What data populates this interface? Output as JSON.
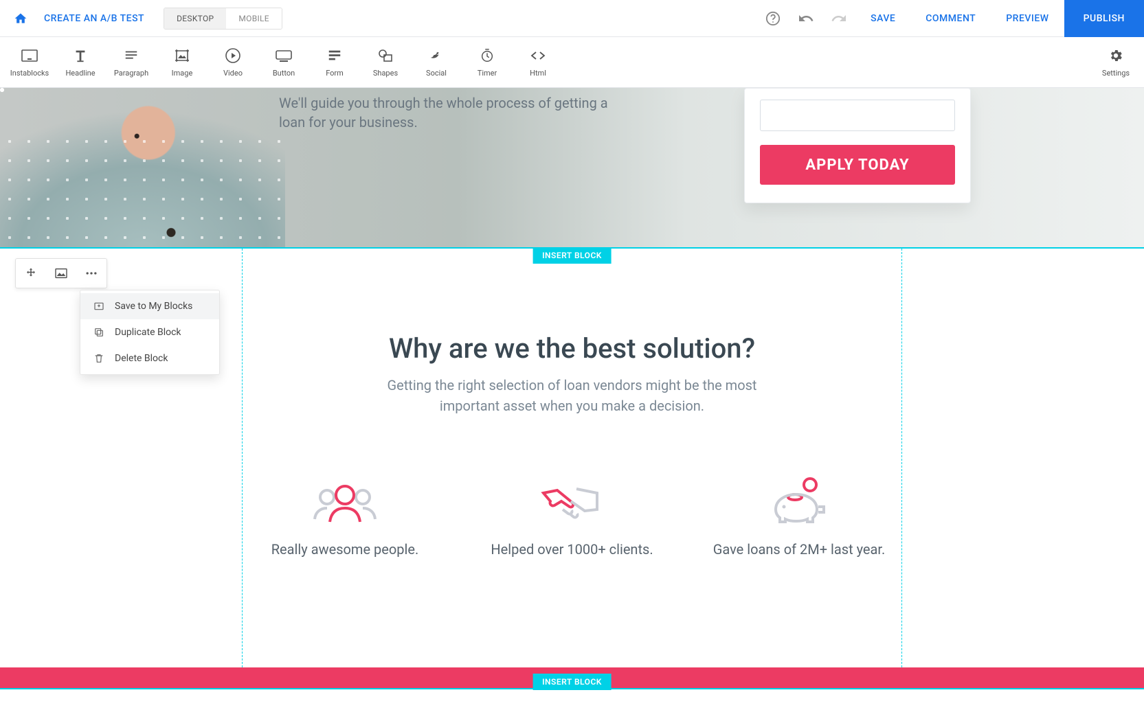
{
  "nav": {
    "ab_test": "CREATE AN A/B TEST",
    "desktop": "DESKTOP",
    "mobile": "MOBILE",
    "save": "SAVE",
    "comment": "COMMENT",
    "preview": "PREVIEW",
    "publish": "PUBLISH"
  },
  "toolbar": {
    "items": [
      {
        "label": "Instablocks",
        "icon": "instablocks-icon"
      },
      {
        "label": "Headline",
        "icon": "headline-icon"
      },
      {
        "label": "Paragraph",
        "icon": "paragraph-icon"
      },
      {
        "label": "Image",
        "icon": "image-icon"
      },
      {
        "label": "Video",
        "icon": "video-icon"
      },
      {
        "label": "Button",
        "icon": "button-icon"
      },
      {
        "label": "Form",
        "icon": "form-icon"
      },
      {
        "label": "Shapes",
        "icon": "shapes-icon"
      },
      {
        "label": "Social",
        "icon": "social-icon"
      },
      {
        "label": "Timer",
        "icon": "timer-icon"
      },
      {
        "label": "Html",
        "icon": "html-icon"
      }
    ],
    "settings": "Settings"
  },
  "hero": {
    "subhead_l1": "We'll guide you through the whole process of getting a",
    "subhead_l2": "loan for your business.",
    "apply_label": "APPLY TODAY"
  },
  "block": {
    "insert_label": "INSERT BLOCK",
    "title": "Why are we the best solution?",
    "subtitle_l1": "Getting the right selection of loan vendors might be the most",
    "subtitle_l2": "important asset when you make a decision.",
    "features": [
      "Really awesome people.",
      "Helped over 1000+ clients.",
      "Gave loans of 2M+ last year."
    ],
    "feature_icons": [
      "people-icon",
      "handshake-icon",
      "piggy-bank-icon"
    ]
  },
  "context_menu": {
    "save": "Save to My Blocks",
    "dup": "Duplicate Block",
    "delete": "Delete Block"
  }
}
